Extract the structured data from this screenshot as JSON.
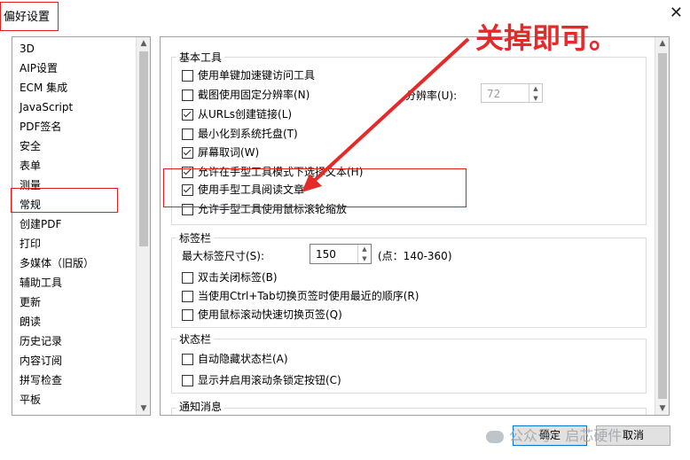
{
  "window": {
    "title": "偏好设置",
    "close_glyph": "✕"
  },
  "sidebar": {
    "items": [
      "3D",
      "AIP设置",
      "ECM 集成",
      "JavaScript",
      "PDF签名",
      "安全",
      "表单",
      "测量",
      "常规",
      "创建PDF",
      "打印",
      "多媒体（旧版）",
      "辅助工具",
      "更新",
      "朗读",
      "历史记录",
      "内容订阅",
      "拼写检查",
      "平板"
    ],
    "selected": "常规"
  },
  "groups": {
    "basic": {
      "label": "基本工具",
      "options": [
        {
          "label": "使用单键加速键访问工具",
          "checked": false
        },
        {
          "label": "截图使用固定分辨率(N)",
          "checked": false
        },
        {
          "label": "从URLs创建链接(L)",
          "checked": true
        },
        {
          "label": "最小化到系统托盘(T)",
          "checked": false
        },
        {
          "label": "屏幕取词(W)",
          "checked": true
        },
        {
          "label": "允许在手型工具模式下选择文本(H)",
          "checked": true
        },
        {
          "label": "使用手型工具阅读文章",
          "checked": true
        },
        {
          "label": "允许手型工具使用鼠标滚轮缩放",
          "checked": false
        }
      ],
      "resolution_label": "分辨率(U):",
      "resolution_value": "72"
    },
    "tabbar": {
      "label": "标签栏",
      "max_size_label": "最大标签尺寸(S):",
      "max_size_value": "150",
      "range_hint": "(点：140-360)",
      "options": [
        {
          "label": "双击关闭标签(B)",
          "checked": false
        },
        {
          "label": "当使用Ctrl+Tab切换页签时使用最近的顺序(R)",
          "checked": false
        },
        {
          "label": "使用鼠标滚动快速切换页签(Q)",
          "checked": false
        }
      ]
    },
    "statusbar": {
      "label": "状态栏",
      "options": [
        {
          "label": "自动隐藏状态栏(A)",
          "checked": false
        },
        {
          "label": "显示并启用滚动条锁定按钮(C)",
          "checked": false
        }
      ]
    },
    "notify": {
      "label": "通知消息"
    }
  },
  "annotation": {
    "text": "关掉即可。",
    "color": "#e52a2a"
  },
  "buttons": {
    "ok": "确定",
    "cancel": "取消"
  },
  "watermark": {
    "text": "公众号 · 启芯硬件"
  },
  "icons": {
    "up": "▲",
    "down": "▼",
    "check": "checkmark-icon",
    "wechat": "wechat-icon"
  },
  "colors": {
    "highlight_box": "#e02020",
    "default_button_border": "#0078d7"
  }
}
